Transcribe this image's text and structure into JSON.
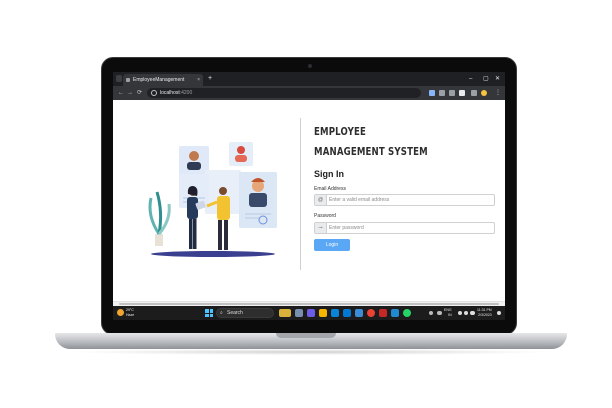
{
  "browser": {
    "tab_title": "EmployeeManagement",
    "tab_close": "×",
    "new_tab": "+",
    "window_controls": {
      "minimize": "–",
      "maximize": "▢",
      "close": "✕"
    },
    "nav": {
      "back": "←",
      "forward": "→",
      "reload": "⟳"
    },
    "url_host": "localhost",
    "url_port": ":4200",
    "menu": "⋮"
  },
  "page": {
    "title_line1": "EMPLOYEE",
    "title_line2": "MANAGEMENT SYSTEM",
    "signin_heading": "Sign In",
    "email": {
      "label": "Email Address",
      "placeholder": "Enter a valid email address",
      "icon": "@"
    },
    "password": {
      "label": "Password",
      "placeholder": "Enter password",
      "icon": "⊸"
    },
    "login_button": "Login"
  },
  "taskbar": {
    "weather_temp": "29°C",
    "weather_desc": "Haze",
    "search_label": "Search",
    "search_icon": "⌕",
    "time": "11:31 PM",
    "date": "2/3/2023",
    "lang": "ENG",
    "lang_sub": "IN",
    "colors": {
      "start": "#4cc2ff",
      "accent": "#5aa7f5"
    }
  }
}
